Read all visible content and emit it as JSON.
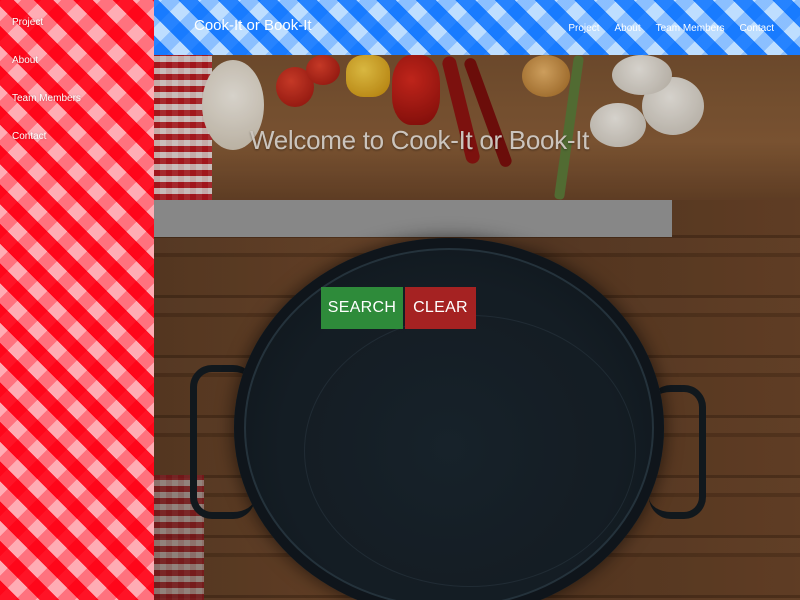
{
  "sidebar": {
    "items": [
      {
        "label": "Project"
      },
      {
        "label": "About"
      },
      {
        "label": "Team Members"
      },
      {
        "label": "Contact"
      }
    ]
  },
  "navbar": {
    "brand": "Cook-It or Book-It",
    "links": [
      {
        "label": "Project"
      },
      {
        "label": "About"
      },
      {
        "label": "Team Members"
      },
      {
        "label": "Contact"
      }
    ]
  },
  "hero": {
    "title": "Welcome to Cook-It or Book-It"
  },
  "search": {
    "value": "",
    "search_label": "SEARCH",
    "clear_label": "CLEAR"
  },
  "colors": {
    "sidebar": "#ff2b3a",
    "navbar": "#3d9bff",
    "search_button": "#2e8b3a",
    "clear_button": "#a52222",
    "search_bar": "#9a9a9a"
  }
}
